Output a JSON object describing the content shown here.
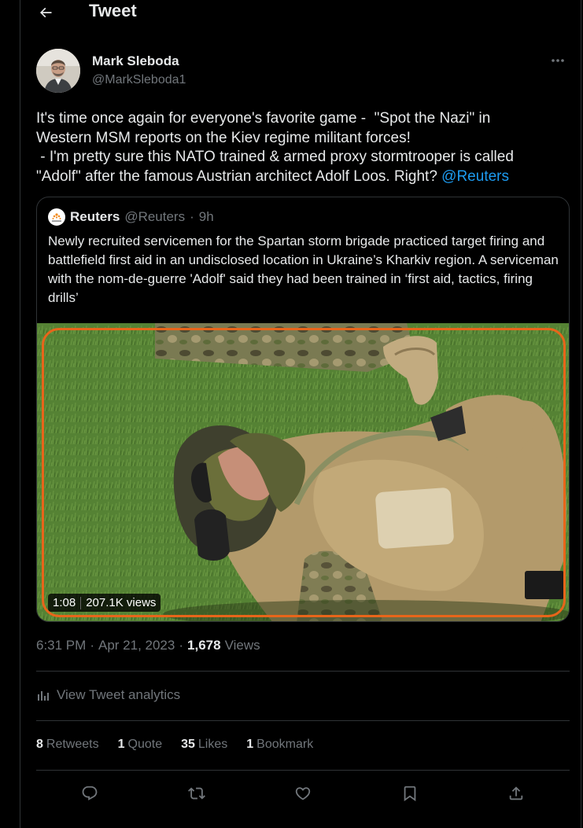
{
  "header": {
    "title": "Tweet",
    "back_icon": "arrow-left-icon"
  },
  "author": {
    "name": "Mark Sleboda",
    "handle": "@MarkSleboda1"
  },
  "tweet": {
    "text": "It's time once again for everyone's favorite game -  \"Spot the Nazi\" in\nWestern MSM reports on the Kiev regime militant forces!\n - I'm pretty sure this NATO trained & armed proxy stormtrooper is called\n\"Adolf\" after the famous Austrian architect Adolf Loos. Right? ",
    "mention": "@Reuters"
  },
  "quote": {
    "name": "Reuters",
    "handle": "@Reuters",
    "separator": "·",
    "time": "9h",
    "text": "Newly recruited servicemen for the Spartan storm brigade practiced target firing and battlefield first aid in an undisclosed location in Ukraine’s Kharkiv region. A serviceman with the nom-de-guerre 'Adolf' said they had been trained in ‘first aid, tactics, firing drills’",
    "video": {
      "duration": "1:08",
      "views": "207.1K views"
    }
  },
  "meta": {
    "time": "6:31 PM",
    "dot1": "·",
    "date": "Apr 21, 2023",
    "dot2": "·",
    "views_count": "1,678",
    "views_label": "Views"
  },
  "analytics": {
    "label": "View Tweet analytics"
  },
  "stats": [
    {
      "count": "8",
      "label": "Retweets"
    },
    {
      "count": "1",
      "label": "Quote"
    },
    {
      "count": "35",
      "label": "Likes"
    },
    {
      "count": "1",
      "label": "Bookmark"
    }
  ],
  "actions": [
    "reply-icon",
    "retweet-icon",
    "like-icon",
    "bookmark-icon",
    "share-icon"
  ],
  "colors": {
    "accent": "#1d9bf0",
    "muted": "#71767b",
    "highlight": "#e8651a",
    "border": "#2f3336"
  }
}
